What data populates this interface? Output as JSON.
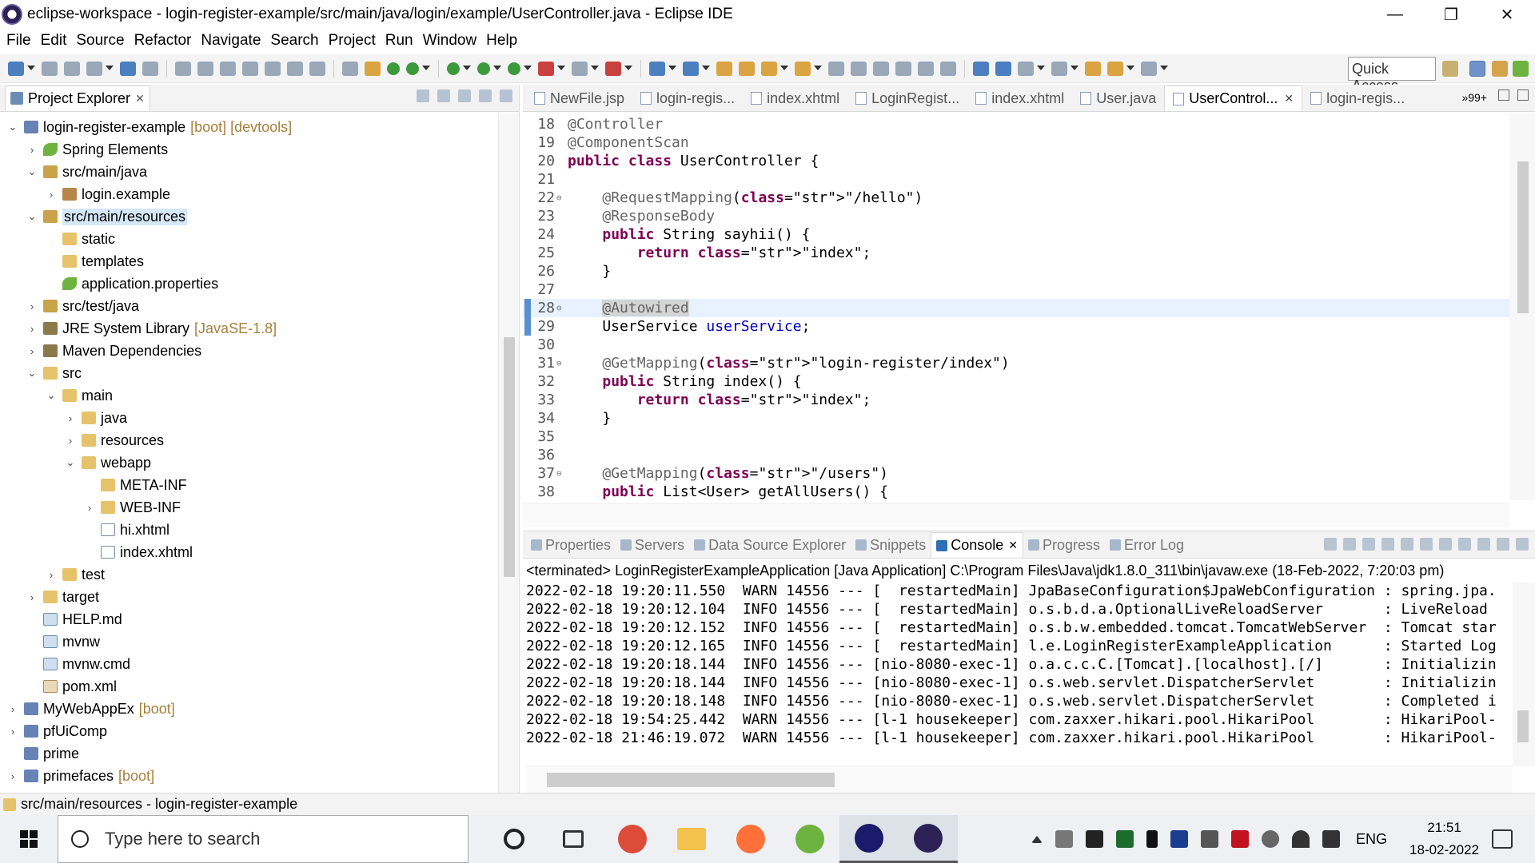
{
  "window": {
    "title": "eclipse-workspace - login-register-example/src/main/java/login/example/UserController.java - Eclipse IDE",
    "controls": [
      "—",
      "❐",
      "✕"
    ]
  },
  "menu": [
    "File",
    "Edit",
    "Source",
    "Refactor",
    "Navigate",
    "Search",
    "Project",
    "Run",
    "Window",
    "Help"
  ],
  "quick_access": "Quick Access",
  "project_explorer": {
    "title": "Project Explorer",
    "rows": [
      {
        "label": "login-register-example",
        "note": "[boot] [devtools]",
        "twisty": "⌄",
        "icon": "proj",
        "depth": 0
      },
      {
        "label": "Spring Elements",
        "note": "",
        "twisty": "›",
        "icon": "spring",
        "depth": 1
      },
      {
        "label": "src/main/java",
        "note": "",
        "twisty": "⌄",
        "icon": "pkgroot",
        "depth": 1
      },
      {
        "label": "login.example",
        "note": "",
        "twisty": "›",
        "icon": "pkg",
        "depth": 2
      },
      {
        "label": "src/main/resources",
        "note": "",
        "twisty": "⌄",
        "icon": "pkgroot",
        "depth": 1,
        "selected": true
      },
      {
        "label": "static",
        "note": "",
        "twisty": "",
        "icon": "folder",
        "depth": 2
      },
      {
        "label": "templates",
        "note": "",
        "twisty": "",
        "icon": "folder",
        "depth": 2
      },
      {
        "label": "application.properties",
        "note": "",
        "twisty": "",
        "icon": "spring",
        "depth": 2
      },
      {
        "label": "src/test/java",
        "note": "",
        "twisty": "›",
        "icon": "pkgroot",
        "depth": 1
      },
      {
        "label": "JRE System Library",
        "note": "[JavaSE-1.8]",
        "twisty": "›",
        "icon": "lib",
        "depth": 1
      },
      {
        "label": "Maven Dependencies",
        "note": "",
        "twisty": "›",
        "icon": "lib",
        "depth": 1
      },
      {
        "label": "src",
        "note": "",
        "twisty": "⌄",
        "icon": "folder",
        "depth": 1
      },
      {
        "label": "main",
        "note": "",
        "twisty": "⌄",
        "icon": "folder",
        "depth": 2
      },
      {
        "label": "java",
        "note": "",
        "twisty": "›",
        "icon": "folder",
        "depth": 3
      },
      {
        "label": "resources",
        "note": "",
        "twisty": "›",
        "icon": "folder",
        "depth": 3
      },
      {
        "label": "webapp",
        "note": "",
        "twisty": "⌄",
        "icon": "folder",
        "depth": 3
      },
      {
        "label": "META-INF",
        "note": "",
        "twisty": "",
        "icon": "folder",
        "depth": 4
      },
      {
        "label": "WEB-INF",
        "note": "",
        "twisty": "›",
        "icon": "folder",
        "depth": 4
      },
      {
        "label": "hi.xhtml",
        "note": "",
        "twisty": "",
        "icon": "file",
        "depth": 4
      },
      {
        "label": "index.xhtml",
        "note": "",
        "twisty": "",
        "icon": "file",
        "depth": 4
      },
      {
        "label": "test",
        "note": "",
        "twisty": "›",
        "icon": "folder",
        "depth": 2
      },
      {
        "label": "target",
        "note": "",
        "twisty": "›",
        "icon": "folder",
        "depth": 1
      },
      {
        "label": "HELP.md",
        "note": "",
        "twisty": "",
        "icon": "plain",
        "depth": 1
      },
      {
        "label": "mvnw",
        "note": "",
        "twisty": "",
        "icon": "plain",
        "depth": 1
      },
      {
        "label": "mvnw.cmd",
        "note": "",
        "twisty": "",
        "icon": "plain",
        "depth": 1
      },
      {
        "label": "pom.xml",
        "note": "",
        "twisty": "",
        "icon": "xml",
        "depth": 1
      },
      {
        "label": "MyWebAppEx",
        "note": "[boot]",
        "twisty": "›",
        "icon": "proj",
        "depth": 0
      },
      {
        "label": "pfUiComp",
        "note": "",
        "twisty": "›",
        "icon": "proj",
        "depth": 0
      },
      {
        "label": "prime",
        "note": "",
        "twisty": "",
        "icon": "proj",
        "depth": 0
      },
      {
        "label": "primefaces",
        "note": "[boot]",
        "twisty": "›",
        "icon": "proj",
        "depth": 0
      }
    ]
  },
  "editor": {
    "tabs": [
      {
        "label": "NewFile.jsp",
        "active": false
      },
      {
        "label": "login-regis...",
        "active": false
      },
      {
        "label": "index.xhtml",
        "active": false
      },
      {
        "label": "LoginRegist...",
        "active": false
      },
      {
        "label": "index.xhtml",
        "active": false
      },
      {
        "label": "User.java",
        "active": false
      },
      {
        "label": "UserControl...",
        "active": true
      },
      {
        "label": "login-regis...",
        "active": false
      }
    ],
    "more_tabs": "»99+",
    "lines": [
      {
        "n": "18",
        "fold": "",
        "code": "@Controller"
      },
      {
        "n": "19",
        "fold": "",
        "code": "@ComponentScan"
      },
      {
        "n": "20",
        "fold": "",
        "code": "public class UserController {"
      },
      {
        "n": "21",
        "fold": "",
        "code": ""
      },
      {
        "n": "22",
        "fold": "⊖",
        "code": "    @RequestMapping(\"/hello\")"
      },
      {
        "n": "23",
        "fold": "",
        "code": "    @ResponseBody"
      },
      {
        "n": "24",
        "fold": "",
        "code": "    public String sayhii() {"
      },
      {
        "n": "25",
        "fold": "",
        "code": "        return \"index\";"
      },
      {
        "n": "26",
        "fold": "",
        "code": "    }"
      },
      {
        "n": "27",
        "fold": "",
        "code": ""
      },
      {
        "n": "28",
        "fold": "⊖",
        "code": "    @Autowired"
      },
      {
        "n": "29",
        "fold": "",
        "code": "    UserService userService;"
      },
      {
        "n": "30",
        "fold": "",
        "code": ""
      },
      {
        "n": "31",
        "fold": "⊖",
        "code": "    @GetMapping(\"login-register/index\")"
      },
      {
        "n": "32",
        "fold": "",
        "code": "    public String index() {"
      },
      {
        "n": "33",
        "fold": "",
        "code": "        return \"index\";"
      },
      {
        "n": "34",
        "fold": "",
        "code": "    }"
      },
      {
        "n": "35",
        "fold": "",
        "code": ""
      },
      {
        "n": "36",
        "fold": "",
        "code": ""
      },
      {
        "n": "37",
        "fold": "⊖",
        "code": "    @GetMapping(\"/users\")"
      },
      {
        "n": "38",
        "fold": "",
        "code": "    public List<User> getAllUsers() {"
      }
    ]
  },
  "console": {
    "tabs": [
      {
        "label": "Properties",
        "active": false
      },
      {
        "label": "Servers",
        "active": false
      },
      {
        "label": "Data Source Explorer",
        "active": false
      },
      {
        "label": "Snippets",
        "active": false
      },
      {
        "label": "Console",
        "active": true
      },
      {
        "label": "Progress",
        "active": false
      },
      {
        "label": "Error Log",
        "active": false
      }
    ],
    "terminated": "<terminated> LoginRegisterExampleApplication [Java Application] C:\\Program Files\\Java\\jdk1.8.0_311\\bin\\javaw.exe (18-Feb-2022, 7:20:03 pm)",
    "lines": [
      "2022-02-18 19:20:11.550  WARN 14556 --- [  restartedMain] JpaBaseConfiguration$JpaWebConfiguration : spring.jpa.",
      "2022-02-18 19:20:12.104  INFO 14556 --- [  restartedMain] o.s.b.d.a.OptionalLiveReloadServer       : LiveReload",
      "2022-02-18 19:20:12.152  INFO 14556 --- [  restartedMain] o.s.b.w.embedded.tomcat.TomcatWebServer  : Tomcat star",
      "2022-02-18 19:20:12.165  INFO 14556 --- [  restartedMain] l.e.LoginRegisterExampleApplication      : Started Log",
      "2022-02-18 19:20:18.144  INFO 14556 --- [nio-8080-exec-1] o.a.c.c.C.[Tomcat].[localhost].[/]       : Initializin",
      "2022-02-18 19:20:18.144  INFO 14556 --- [nio-8080-exec-1] o.s.web.servlet.DispatcherServlet        : Initializin",
      "2022-02-18 19:20:18.148  INFO 14556 --- [nio-8080-exec-1] o.s.web.servlet.DispatcherServlet        : Completed i",
      "2022-02-18 19:54:25.442  WARN 14556 --- [l-1 housekeeper] com.zaxxer.hikari.pool.HikariPool        : HikariPool-",
      "2022-02-18 21:46:19.072  WARN 14556 --- [l-1 housekeeper] com.zaxxer.hikari.pool.HikariPool        : HikariPool-"
    ]
  },
  "status_bar": "src/main/resources - login-register-example",
  "taskbar": {
    "search_placeholder": "Type here to search",
    "language": "ENG",
    "time": "21:51",
    "date": "18-02-2022",
    "apps": [
      {
        "name": "cortana-icon",
        "color": "#222222"
      },
      {
        "name": "task-view-icon",
        "color": "#333333"
      },
      {
        "name": "chrome-icon",
        "color": "#dd4b39"
      },
      {
        "name": "file-explorer-icon",
        "color": "#f2c14e"
      },
      {
        "name": "firefox-icon",
        "color": "#ff7139"
      },
      {
        "name": "spring-tool-icon",
        "color": "#6db33f"
      },
      {
        "name": "webex-icon",
        "color": "#1b1b6b"
      },
      {
        "name": "eclipse-icon",
        "color": "#2c2255"
      }
    ]
  }
}
